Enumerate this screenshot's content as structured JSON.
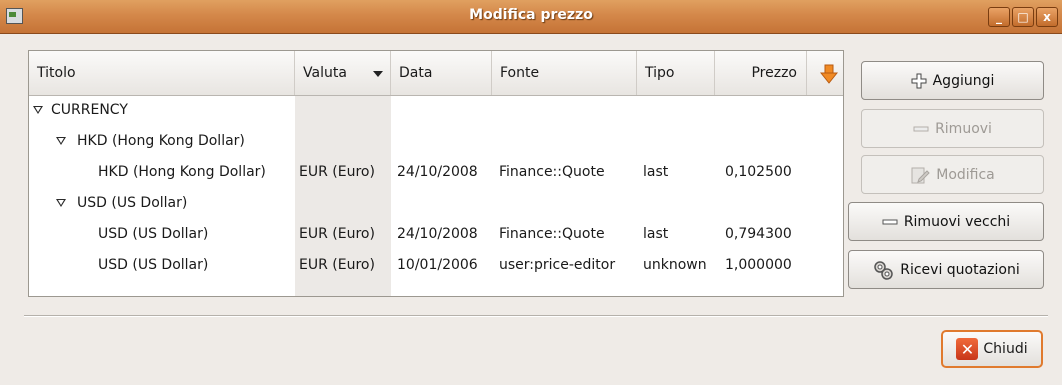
{
  "window": {
    "title": "Modifica prezzo",
    "controls": {
      "minimize": "_",
      "maximize": "□",
      "close": "x"
    }
  },
  "table": {
    "columns": [
      "Titolo",
      "Valuta",
      "Data",
      "Fonte",
      "Tipo",
      "Prezzo"
    ],
    "rows": [
      {
        "level": 0,
        "expanded": true,
        "title": "CURRENCY"
      },
      {
        "level": 1,
        "expanded": true,
        "title": "HKD (Hong Kong Dollar)"
      },
      {
        "level": 2,
        "title": "HKD (Hong Kong Dollar)",
        "currency": "EUR (Euro)",
        "date": "24/10/2008",
        "source": "Finance::Quote",
        "type": "last",
        "price": "0,102500"
      },
      {
        "level": 1,
        "expanded": true,
        "title": "USD (US Dollar)"
      },
      {
        "level": 2,
        "title": "USD (US Dollar)",
        "currency": "EUR (Euro)",
        "date": "24/10/2008",
        "source": "Finance::Quote",
        "type": "last",
        "price": "0,794300"
      },
      {
        "level": 2,
        "title": "USD (US Dollar)",
        "currency": "EUR (Euro)",
        "date": "10/01/2006",
        "source": "user:price-editor",
        "type": "unknown",
        "price": "1,000000"
      }
    ]
  },
  "buttons": {
    "add": "Aggiungi",
    "remove": "Rimuovi",
    "edit": "Modifica",
    "remove_old": "Rimuovi vecchi",
    "get_quotes": "Ricevi quotazioni",
    "close": "Chiudi"
  },
  "colors": {
    "titlebar": "#d4884a",
    "accent": "#e07a2e",
    "window_bg": "#efebe7"
  }
}
